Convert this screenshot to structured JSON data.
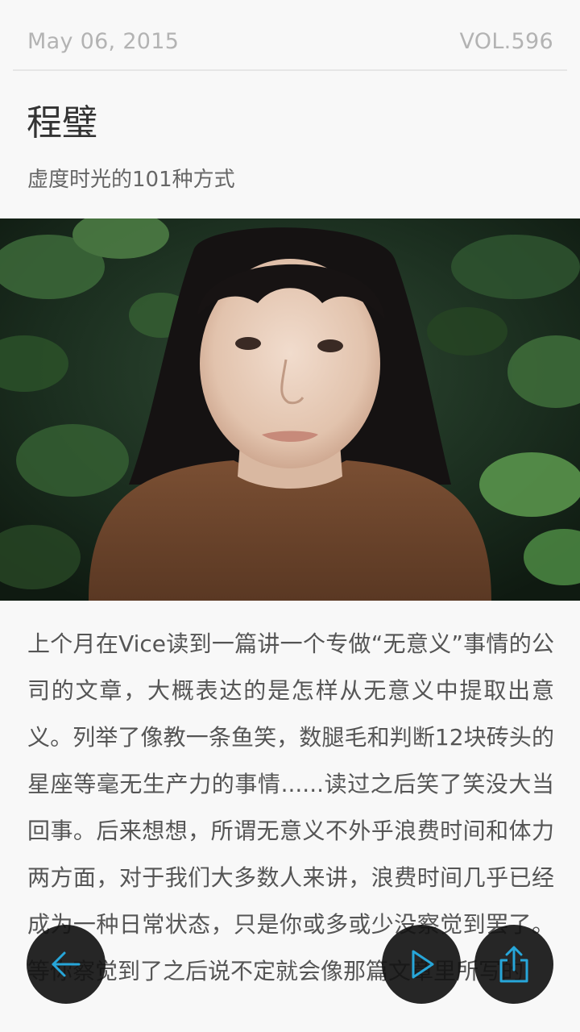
{
  "header": {
    "date": "May 06, 2015",
    "volume": "VOL.596"
  },
  "article": {
    "author": "程璧",
    "subtitle": "虚度时光的101种方式",
    "body": "上个月在Vice读到一篇讲一个专做“无意义”事情的公司的文章，大概表达的是怎样从无意义中提取出意义。列举了像教一条鱼笑，数腿毛和判断12块砖头的星座等毫无生产力的事情......读过之后笑了笑没大当回事。后来想想，所谓无意义不外乎浪费时间和体力两方面，对于我们大多数人来讲，浪费时间几乎已经成为一种日常状态，只是你或多或少没察觉到罢了。等你察觉到了之后说不定就会像那篇文章里所写的"
  },
  "photo": {
    "subject": "portrait-photo"
  },
  "controls": {
    "back_icon": "arrow-left-icon",
    "play_icon": "play-icon",
    "share_icon": "share-icon",
    "accent_color": "#27a6d9",
    "button_color": "#141414"
  }
}
